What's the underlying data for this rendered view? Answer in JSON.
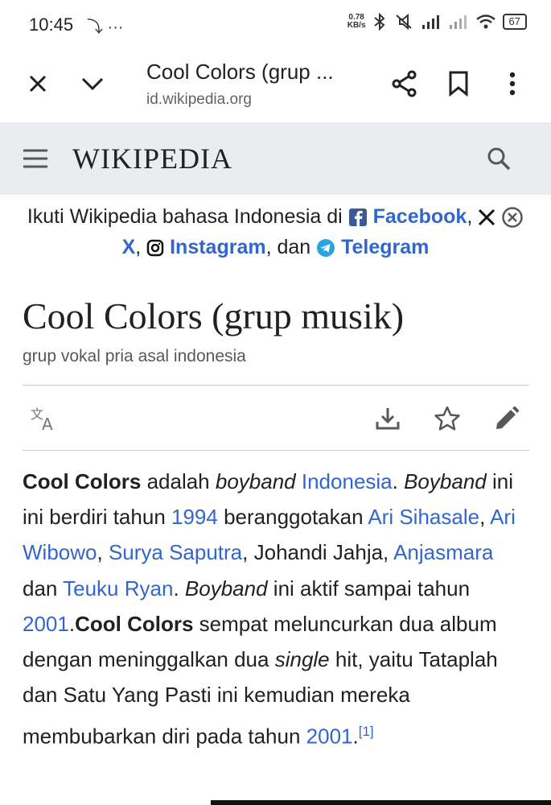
{
  "status_bar": {
    "time": "10:45",
    "left_icons": "⤵ ···",
    "net_speed_top": "0.78",
    "net_speed_bottom": "KB/s",
    "battery": "67"
  },
  "browser": {
    "close_icon": "close-icon",
    "collapse_icon": "chevron-down-icon",
    "page_title": "Cool Colors (grup ...",
    "url": "id.wikipedia.org",
    "share_icon": "share-icon",
    "bookmark_icon": "bookmark-icon",
    "menu_icon": "more-vert-icon"
  },
  "wiki_header": {
    "menu_icon": "hamburger-icon",
    "wordmark": "WIKIPEDIA",
    "search_icon": "search-icon"
  },
  "banner": {
    "prefix": "Ikuti Wikipedia bahasa Indonesia di ",
    "facebook": "Facebook",
    "comma1": ",",
    "x_label": "X",
    "comma2": ",",
    "instagram": "Instagram",
    "and_text": ", dan ",
    "telegram": "Telegram"
  },
  "article": {
    "title": "Cool Colors (grup musik)",
    "subtitle": "grup vokal pria asal indonesia",
    "actions": {
      "language_icon": "translate-icon",
      "download_icon": "download-icon",
      "watch_icon": "star-icon",
      "edit_icon": "pencil-icon"
    },
    "p": {
      "s1": "Cool Colors",
      "s2": " adalah ",
      "s3": "boyband",
      "s4": " ",
      "l1": "Indonesia",
      "s5": ". ",
      "s6": "Boyband",
      "s7": " ini ini berdiri tahun ",
      "l2": "1994",
      "s8": " beranggotakan ",
      "l3": "Ari Sihasale",
      "s9": ", ",
      "l4": "Ari Wibowo",
      "s10": ", ",
      "l5": "Surya Saputra",
      "s11": ", Johandi Jahja, ",
      "l6": "Anjasmara",
      "s12": " dan ",
      "l7": "Teuku Ryan",
      "s13": ". ",
      "s14": "Boyband",
      "s15": " ini aktif sampai tahun ",
      "l8": "2001",
      "s16": ".",
      "s17": "Cool Colors",
      "s18": " sempat meluncurkan dua album dengan meninggalkan dua ",
      "s19": "single",
      "s20": " hit, yaitu Tataplah dan Satu Yang Pasti ini kemudian mereka membubarkan diri pada tahun ",
      "l9": "2001",
      "s21": ".",
      "ref": "[1]"
    }
  },
  "colors": {
    "link": "#3366cc",
    "header_bg": "#eaecf0",
    "text": "#202122"
  }
}
